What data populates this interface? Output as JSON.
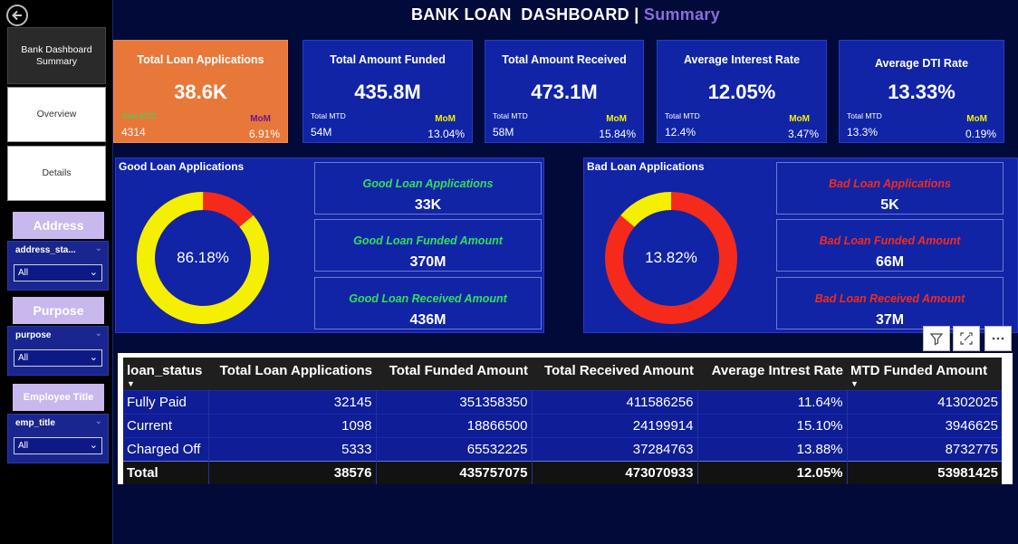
{
  "title": {
    "main": "BANK LOAN  DASHBOARD | ",
    "accent": "Summary"
  },
  "nav": {
    "summary": "Bank Dashboard Summary",
    "overview": "Overview",
    "details": "Details"
  },
  "slicers": {
    "address": {
      "header": "Address",
      "field": "address_sta...",
      "value": "All"
    },
    "purpose": {
      "header": "Purpose",
      "field": "purpose",
      "value": "All"
    },
    "employee": {
      "header": "Employee Title",
      "field": "emp_title",
      "value": "All"
    }
  },
  "kpis": [
    {
      "title": "Total Loan Applications",
      "value": "38.6K",
      "mtd_label": "Total MTD",
      "mtd": "4314",
      "mom_label": "MoM",
      "mom": "6.91%"
    },
    {
      "title": "Total Amount Funded",
      "value": "435.8M",
      "mtd_label": "Total MTD",
      "mtd": "54M",
      "mom_label": "MoM",
      "mom": "13.04%"
    },
    {
      "title": "Total Amount Received",
      "value": "473.1M",
      "mtd_label": "Total MTD",
      "mtd": "58M",
      "mom_label": "MoM",
      "mom": "15.84%"
    },
    {
      "title": "Average Interest Rate",
      "value": "12.05%",
      "mtd_label": "Total MTD",
      "mtd": "12.4%",
      "mom_label": "MoM",
      "mom": "3.47%"
    },
    {
      "title": "Average DTI Rate",
      "value": "13.33%",
      "mtd_label": "Total MTD",
      "mtd": "13.3%",
      "mom_label": "MoM",
      "mom": "0.19%"
    }
  ],
  "good": {
    "title": "Good Loan Applications",
    "donut_pct": "86.18%",
    "donut_fraction": 0.8618,
    "cards": [
      {
        "label": "Good Loan Applications",
        "value": "33K"
      },
      {
        "label": "Good Loan Funded Amount",
        "value": "370M"
      },
      {
        "label": "Good Loan Received Amount",
        "value": "436M"
      }
    ]
  },
  "bad": {
    "title": "Bad Loan Applications",
    "donut_pct": "13.82%",
    "donut_fraction": 0.1382,
    "cards": [
      {
        "label": "Bad Loan Applications",
        "value": "5K"
      },
      {
        "label": "Bad Loan Funded Amount",
        "value": "66M"
      },
      {
        "label": "Bad Loan Received Amount",
        "value": "37M"
      }
    ]
  },
  "colors": {
    "good_fill": "#f4f000",
    "bad_fill": "#f52a1a",
    "kpi_bg": "#1124a6",
    "kpi_accent": "#e8773a"
  },
  "table": {
    "headers": [
      "loan_status",
      "Total Loan Applications",
      "Total Funded Amount",
      "Total Received Amount",
      "Average Intrest Rate",
      "MTD Funded Amount"
    ],
    "rows": [
      [
        "Fully Paid",
        "32145",
        "351358350",
        "411586256",
        "11.64%",
        "41302025"
      ],
      [
        "Current",
        "1098",
        "18866500",
        "24199914",
        "15.10%",
        "3946625"
      ],
      [
        "Charged Off",
        "5333",
        "65532225",
        "37284763",
        "13.88%",
        "8732775"
      ]
    ],
    "total": [
      "Total",
      "38576",
      "435757075",
      "473070933",
      "12.05%",
      "53981425"
    ]
  },
  "icons": [
    "back-arrow-icon",
    "filter-icon",
    "focus-mode-icon",
    "more-options-icon",
    "chevron-down-icon",
    "sort-descending-icon"
  ]
}
